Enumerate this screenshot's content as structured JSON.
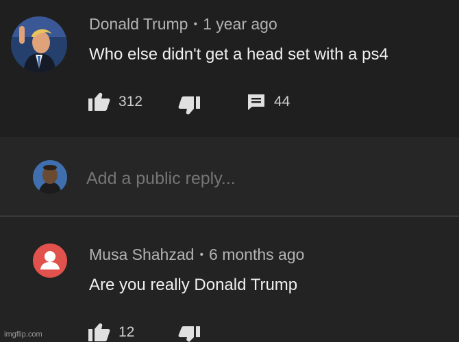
{
  "comment": {
    "author": "Donald Trump",
    "time": "1 year ago",
    "text": "Who else didn't get a head set with a ps4",
    "likes": "312",
    "replies": "44",
    "separator": "•"
  },
  "reply_box": {
    "placeholder": "Add a public reply..."
  },
  "reply": {
    "author": "Musa Shahzad",
    "time": "6 months ago",
    "text": "Are you really Donald Trump",
    "likes": "12",
    "separator": "•"
  },
  "watermark": "imgflip.com",
  "colors": {
    "text": "#f0f0f0",
    "meta": "#b3b3b3",
    "icon": "#e0e0e0",
    "default_avatar": "#e0524b"
  }
}
